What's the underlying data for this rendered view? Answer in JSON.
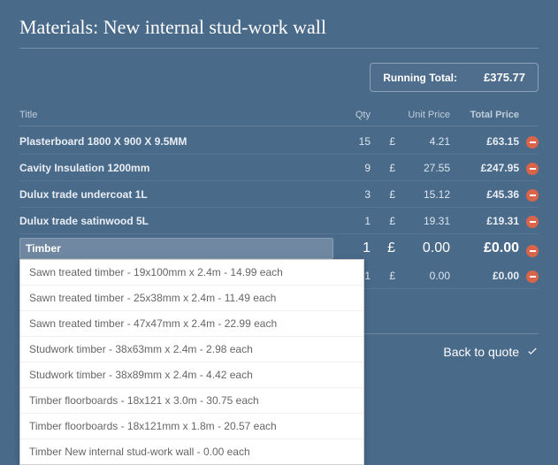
{
  "title": "Materials: New internal stud-work wall",
  "running": {
    "label": "Running Total:",
    "value": "£375.77"
  },
  "headers": {
    "title": "Title",
    "qty": "Qty",
    "unit": "Unit Price",
    "total": "Total Price"
  },
  "currency": "£",
  "rows": [
    {
      "title": "Plasterboard 1800 X 900 X 9.5MM",
      "qty": "15",
      "unit": "4.21",
      "total": "£63.15"
    },
    {
      "title": "Cavity Insulation 1200mm",
      "qty": "9",
      "unit": "27.55",
      "total": "£247.95"
    },
    {
      "title": "Dulux trade undercoat 1L",
      "qty": "3",
      "unit": "15.12",
      "total": "£45.36"
    },
    {
      "title": "Dulux trade satinwood 5L",
      "qty": "1",
      "unit": "19.31",
      "total": "£19.31"
    },
    {
      "title": "__INPUT__",
      "qty": "1",
      "unit": "0.00",
      "total": "£0.00"
    },
    {
      "title": "",
      "qty": "1",
      "unit": "0.00",
      "total": "£0.00"
    }
  ],
  "input_value": "Timber",
  "dropdown": [
    "Sawn treated timber - 19x100mm x 2.4m - 14.99 each",
    "Sawn treated timber - 25x38mm x 2.4m - 11.49 each",
    "Sawn treated timber - 47x47mm x 2.4m - 22.99 each",
    "Studwork timber - 38x63mm x 2.4m - 2.98 each",
    "Studwork timber - 38x89mm x 2.4m - 4.42 each",
    "Timber floorboards - 18x121 x 3.0m - 30.75 each",
    "Timber floorboards - 18x121mm x 1.8m - 20.57 each",
    "Timber New internal stud-work wall - 0.00 each"
  ],
  "back": "Back to quote"
}
